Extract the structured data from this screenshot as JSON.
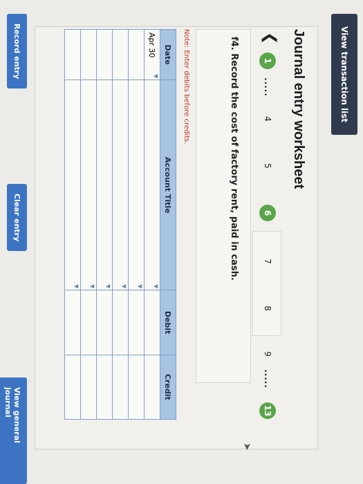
{
  "header": {
    "view_list_label": "View transaction list"
  },
  "title": "Journal entry worksheet",
  "stepper": {
    "steps": [
      "1",
      ".....",
      "4",
      "5",
      "6",
      "7",
      "8",
      "9",
      ".....",
      "13"
    ]
  },
  "question": "f4. Record the cost of factory rent, paid in cash.",
  "note": "Note: Enter debits before credits.",
  "table": {
    "headers": [
      "Date",
      "Account Title",
      "Debit",
      "Credit"
    ],
    "rows": [
      [
        "Apr 30",
        "",
        "",
        ""
      ],
      [
        "",
        "",
        "",
        ""
      ],
      [
        "",
        "",
        "",
        ""
      ],
      [
        "",
        "",
        "",
        ""
      ],
      [
        "",
        "",
        "",
        ""
      ],
      [
        "",
        "",
        "",
        ""
      ]
    ]
  },
  "buttons": {
    "record": "Record entry",
    "clear": "Clear entry",
    "view_journal": "View general journal"
  },
  "colors": {
    "header_btn": "#2f3a4e",
    "step_done": "#5aa54a",
    "table_header": "#a9c4e3",
    "action_btn": "#3c74c3",
    "note": "#c0392b"
  }
}
